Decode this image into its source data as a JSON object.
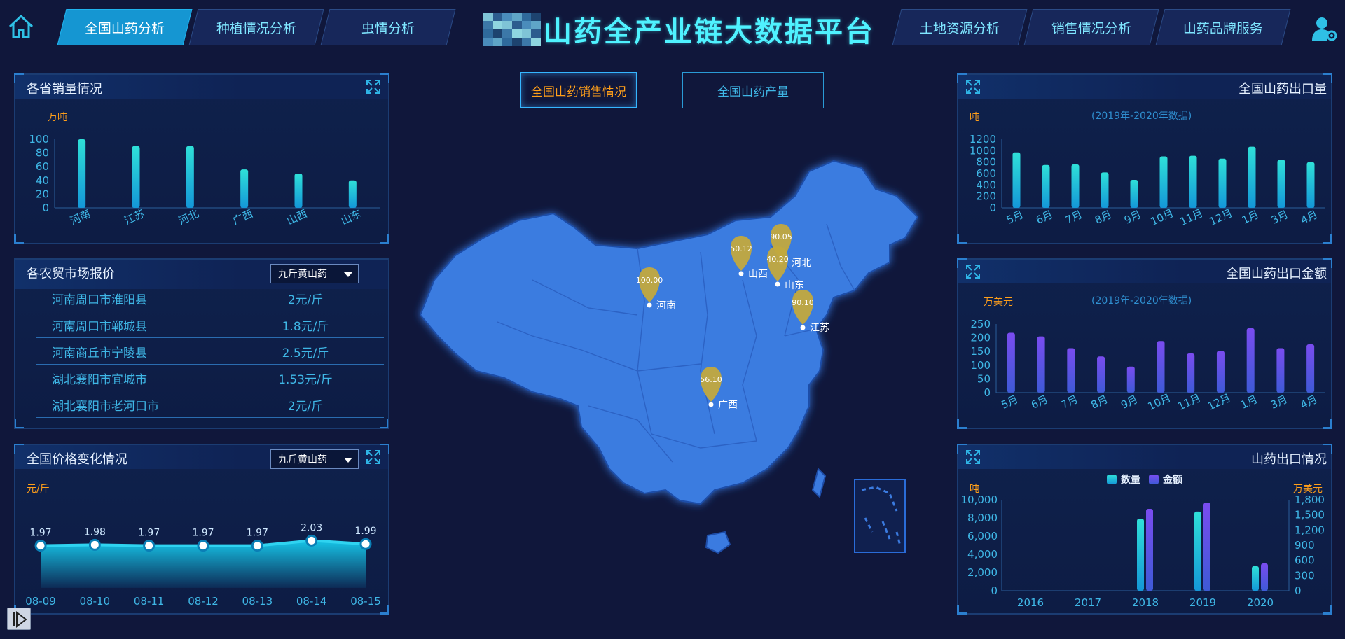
{
  "nav": {
    "left": [
      "全国山药分析",
      "种植情况分析",
      "虫情分析"
    ],
    "right": [
      "土地资源分析",
      "销售情况分析",
      "山药品牌服务"
    ],
    "active_index": 0
  },
  "title": "山药全产业链大数据平台",
  "toggles": [
    "全国山药销售情况",
    "全国山药产量"
  ],
  "colors": {
    "accent": "#4ff2ff",
    "active_nav": "#1596d2",
    "orange": "#ff9f1a",
    "teal_bar": "#28d3d6",
    "purple_bar": "#6a45e6",
    "map_fill": "#3a7be0",
    "pin": "#c2a93e"
  },
  "icons": {
    "home": "home-icon",
    "user": "user-settings-icon",
    "expand": "expand-icon",
    "play": "play-icon"
  },
  "panels": {
    "province_sales": {
      "title": "各省销量情况",
      "unit": "万吨"
    },
    "market_prices": {
      "title": "各农贸市场报价",
      "dropdown": "九斤黄山药",
      "rows": [
        {
          "loc": "河南周口市淮阳县",
          "price": "2元/斤"
        },
        {
          "loc": "河南周口市郸城县",
          "price": "1.8元/斤"
        },
        {
          "loc": "河南商丘市宁陵县",
          "price": "2.5元/斤"
        },
        {
          "loc": "湖北襄阳市宜城市",
          "price": "1.53元/斤"
        },
        {
          "loc": "湖北襄阳市老河口市",
          "price": "2元/斤"
        }
      ]
    },
    "price_trend": {
      "title": "全国价格变化情况",
      "dropdown": "九斤黄山药",
      "unit": "元/斤"
    },
    "export_volume": {
      "title": "全国山药出口量",
      "unit": "吨",
      "subtitle": "(2019年-2020年数据)"
    },
    "export_amount": {
      "title": "全国山药出口金额",
      "unit": "万美元",
      "subtitle": "(2019年-2020年数据)"
    },
    "export_status": {
      "title": "山药出口情况",
      "unit_left": "吨",
      "unit_right": "万美元"
    }
  },
  "map": {
    "pins": [
      {
        "name": "河南",
        "value": "100.00"
      },
      {
        "name": "山西",
        "value": "50.12"
      },
      {
        "name": "河北",
        "value": "90.05"
      },
      {
        "name": "山东",
        "value": "40.20"
      },
      {
        "name": "江苏",
        "value": "90.10"
      },
      {
        "name": "广西",
        "value": "56.10"
      }
    ]
  },
  "chart_data": [
    {
      "type": "bar",
      "title": "各省销量情况",
      "ylabel": "万吨",
      "categories": [
        "河南",
        "江苏",
        "河北",
        "广西",
        "山西",
        "山东"
      ],
      "values": [
        100,
        90,
        90,
        56,
        50,
        40
      ],
      "ylim": [
        0,
        100
      ],
      "yticks": [
        0,
        20,
        40,
        60,
        80,
        100
      ]
    },
    {
      "type": "area",
      "title": "全国价格变化情况",
      "ylabel": "元/斤",
      "categories": [
        "08-09",
        "08-10",
        "08-11",
        "08-12",
        "08-13",
        "08-14",
        "08-15"
      ],
      "values": [
        1.97,
        1.98,
        1.97,
        1.97,
        1.97,
        2.03,
        1.99
      ]
    },
    {
      "type": "bar",
      "title": "全国山药出口量",
      "subtitle": "(2019年-2020年数据)",
      "ylabel": "吨",
      "categories": [
        "5月",
        "6月",
        "7月",
        "8月",
        "9月",
        "10月",
        "11月",
        "12月",
        "1月",
        "3月",
        "4月"
      ],
      "values": [
        970,
        750,
        760,
        620,
        490,
        900,
        910,
        860,
        1070,
        840,
        800
      ],
      "ylim": [
        0,
        1200
      ],
      "yticks": [
        0,
        200,
        400,
        600,
        800,
        1000,
        1200
      ]
    },
    {
      "type": "bar",
      "title": "全国山药出口金额",
      "subtitle": "(2019年-2020年数据)",
      "ylabel": "万美元",
      "categories": [
        "5月",
        "6月",
        "7月",
        "8月",
        "9月",
        "10月",
        "11月",
        "12月",
        "1月",
        "3月",
        "4月"
      ],
      "values": [
        218,
        205,
        162,
        132,
        95,
        188,
        143,
        152,
        235,
        162,
        176
      ],
      "ylim": [
        0,
        250
      ],
      "yticks": [
        0,
        50,
        100,
        150,
        200,
        250
      ]
    },
    {
      "type": "bar",
      "title": "山药出口情况",
      "categories": [
        "2016",
        "2017",
        "2018",
        "2019",
        "2020"
      ],
      "series": [
        {
          "name": "数量",
          "axis": "left",
          "unit": "吨",
          "values": [
            0,
            0,
            7900,
            8700,
            2700
          ]
        },
        {
          "name": "金额",
          "axis": "right",
          "unit": "万美元",
          "values": [
            0,
            0,
            1620,
            1740,
            540
          ]
        }
      ],
      "ylim_left": [
        0,
        10000
      ],
      "ylim_right": [
        0,
        1800
      ],
      "yticks_left": [
        "0",
        "2,000",
        "4,000",
        "6,000",
        "8,000",
        "10,000"
      ],
      "yticks_right": [
        "0",
        "300",
        "600",
        "900",
        "1,200",
        "1,500",
        "1,800"
      ],
      "legend": "top-center"
    }
  ]
}
